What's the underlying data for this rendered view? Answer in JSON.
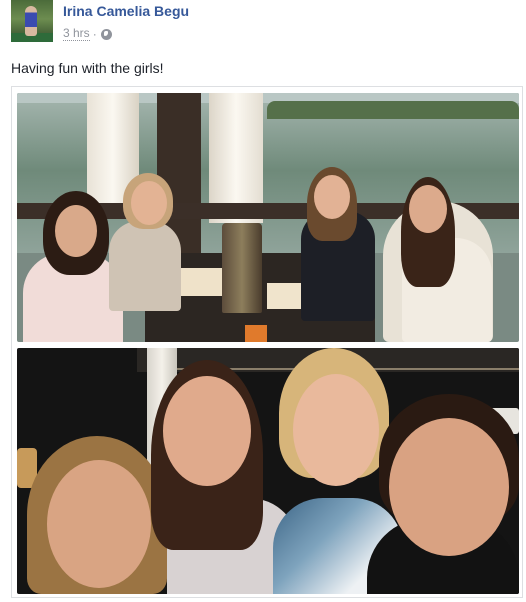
{
  "post": {
    "author": "Irina Camelia Begu",
    "timestamp": "3 hrs",
    "separator": "·",
    "privacy_icon": "globe-icon",
    "text": "Having fun with the girls!"
  },
  "colors": {
    "author_link": "#365899",
    "meta_text": "#90949c",
    "body_text": "#1d2129",
    "frame_border": "#dddfe2"
  }
}
